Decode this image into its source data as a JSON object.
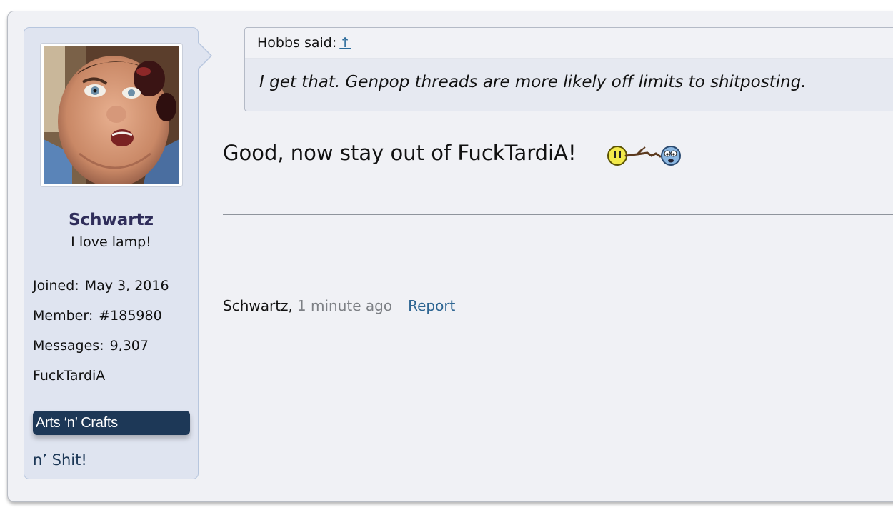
{
  "user": {
    "name": "Schwartz",
    "title": "I love lamp!",
    "stats": [
      {
        "label": "Joined:",
        "value": "May 3, 2016"
      },
      {
        "label": "Member:",
        "value": "#185980"
      },
      {
        "label": "Messages:",
        "value": "9,307"
      }
    ],
    "location": "FuckTardiA",
    "group_banner": "Arts ‘n’ Crafts",
    "extra_text": "n’ Shit!"
  },
  "quote": {
    "attribution": "Hobbs said:",
    "jump_icon": "↑",
    "text": "I get that. Genpop threads are more likely off limits to shitposting."
  },
  "post": {
    "message": "Good, now stay out of FuckTardiA!",
    "smiley_icon": "smiley-kick-chain-icon"
  },
  "footer": {
    "author": "Schwartz,",
    "time": "1 minute ago",
    "report_label": "Report"
  },
  "colors": {
    "panel_bg": "#dfe4f0",
    "username": "#2f2d5a",
    "banner_bg": "#1d3857",
    "link": "#2d6592"
  }
}
